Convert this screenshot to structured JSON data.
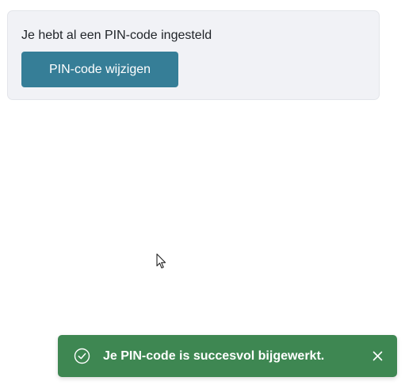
{
  "pin_card": {
    "status_text": "Je hebt al een PIN-code ingesteld",
    "change_button_label": "PIN-code wijzigen"
  },
  "toast": {
    "message": "Je PIN-code is succesvol bijgewerkt.",
    "icon": "check-circle-icon",
    "close_icon": "close-icon"
  },
  "colors": {
    "accent": "#367e97",
    "success": "#3e8752",
    "card_background": "#f1f2f6"
  }
}
